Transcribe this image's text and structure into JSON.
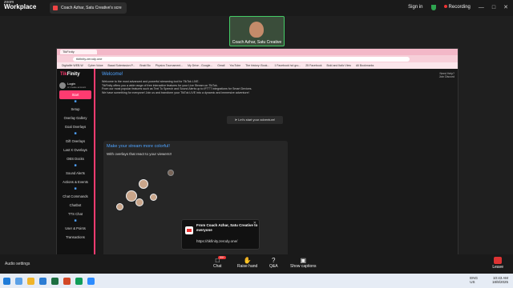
{
  "zoom": {
    "brand_small": "zoom",
    "brand": "Workplace",
    "share_title": "Coach Azhar, Satu Creative's scre",
    "sign_in": "Sign in",
    "recording": "Recording"
  },
  "video": {
    "name": "Coach Azhar, Satu Creative"
  },
  "browser": {
    "tab": "TikFinity",
    "url": "tikfinity.zerody.one",
    "bookmarks": [
      "Digitalife WEB.W",
      "Cyber Voice",
      "Baaal Submission P...",
      "Braid Bo",
      "Physics Tournament...",
      "My Drive - Google...",
      "Gmail",
      "YouTube",
      "The history: Book...",
      "1 Facebook hol gro...",
      "25 Facebook",
      "Bold and Italic View",
      "All Bookmarks"
    ]
  },
  "app": {
    "logo_tik": "Tik",
    "logo_rest": "Finity",
    "login": "Login",
    "login_sub": "or create account",
    "nav": [
      "Start",
      "Setup",
      "Overlay Gallery",
      "Goal Overlays",
      "Gift Overlays",
      "Last X Overlays",
      "OBS Docks",
      "Sound Alerts",
      "Actions & Events",
      "Chat Commands",
      "Chatbot",
      "TTS Chat",
      "User & Points",
      "Transactions"
    ],
    "welcome": "Welcome!",
    "intro1": "Welcome to the most advanced and powerful streaming tool for TikTok LIVE.",
    "intro2": "TikFinity offers you a wide range of free interactive features for your Live Stream on TikTok.",
    "intro3": "From our most popular features such as Text To Speech and Sound Alerts up to IFTTT integrations for Smart Devices.",
    "intro4": "We have something for everyone! Join us and transform your TikTok LIVE into a dynamic and immersive adventure!",
    "adventure_btn": "Let's start your adventure!",
    "help": "Need Help?",
    "help_sub": "Join Discord",
    "card_title": "Make your stream more colorful!",
    "card_text": "With overlays that react to your viewers!!"
  },
  "toast": {
    "title": "From Coach Azhar, Satu Creative to everyone",
    "url": "https://tikfinity.zerody.one/"
  },
  "toolbar": {
    "audio": "Audio settings",
    "chat": "Chat",
    "chat_badge": "99+",
    "raise": "Raise hand",
    "qa": "Q&A",
    "captions": "Show captions",
    "leave": "Leave"
  },
  "taskbar": {
    "lang1": "ENG",
    "lang2": "US",
    "time": "10:43 AM",
    "date": "18/8/2025"
  }
}
